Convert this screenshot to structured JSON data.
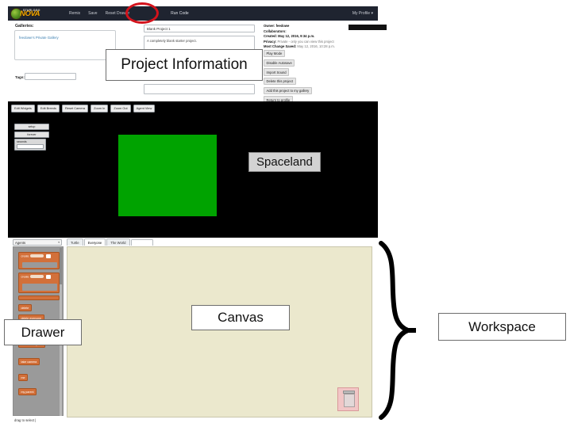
{
  "navbar": {
    "logo_star": "STARLOGO",
    "logo_nova": "NOVA",
    "items": [
      "Remix",
      "Save",
      "Reset Drawer"
    ],
    "run_code": "Run Code",
    "profile": "My Profile ▾"
  },
  "project_info": {
    "galleries_label": "Galleries:",
    "gallery_link": "feedowe's Private Gallery",
    "tags_label": "Tags:",
    "tags_value": "",
    "title_value": "Blank Project 1",
    "description_value": "A completely blank starter project.",
    "meta": [
      {
        "label": "Owner:",
        "value": "feedowe"
      },
      {
        "label": "Collaborators:",
        "value": ""
      },
      {
        "label": "Created:",
        "value": "May 12, 2016, 9:34 p.m."
      },
      {
        "label": "Privacy:",
        "value": "Private - only you can view this project"
      },
      {
        "label": "Most Change Saved:",
        "value": "May 12, 2016, 10:28 p.m."
      }
    ],
    "buttons": [
      "Play Mode",
      "Disable Autosave",
      "Import Sound",
      "Delete this project",
      "Add this project to my gallery",
      "Return to profile"
    ]
  },
  "spaceland": {
    "toolbar": [
      "Edit Widgets",
      "Edit Breeds",
      "Reset Camera",
      "Zoom In",
      "Zoom Out",
      "Agent View"
    ],
    "widgets": {
      "buttons": [
        "setup",
        "forever"
      ],
      "slider_label": "seconds"
    },
    "ground_color": "#00a300",
    "background_color": "#000000"
  },
  "workspace": {
    "agents_select": "Agents",
    "tabs": [
      {
        "label": "Turtle",
        "active": false
      },
      {
        "label": "Everyone",
        "active": true
      },
      {
        "label": "The World",
        "active": false
      }
    ],
    "drawer_blocks": [
      {
        "text": "create",
        "kind": "create"
      },
      {
        "text": "create",
        "kind": "create-do"
      },
      {
        "text": "",
        "kind": "long"
      },
      {
        "text": "delete",
        "kind": "simple"
      },
      {
        "text": "delete everyone",
        "kind": "simple"
      },
      {
        "text": "create agent",
        "kind": "create-agent"
      },
      {
        "text": "scatter everyone",
        "kind": "simple"
      },
      {
        "text": "take camera",
        "kind": "simple"
      },
      {
        "text": "me",
        "kind": "simple"
      },
      {
        "text": "my parent",
        "kind": "simple"
      }
    ],
    "drag_hint": "drag to select |",
    "canvas_color": "#ebe8cd",
    "trash_icon": "trash-icon"
  },
  "annotations": {
    "project_information": "Project Information",
    "spaceland": "Spaceland",
    "drawer": "Drawer",
    "canvas": "Canvas",
    "workspace": "Workspace",
    "highlight_color": "#d3131c"
  }
}
